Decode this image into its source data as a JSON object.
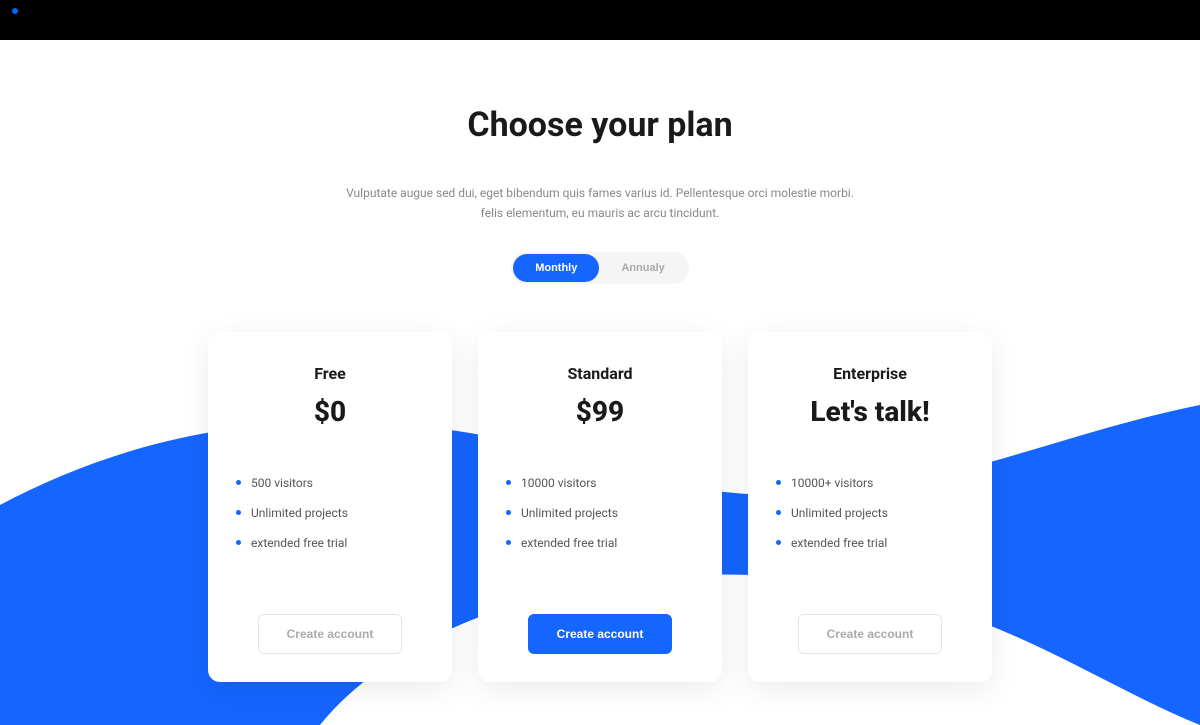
{
  "heading": "Choose your plan",
  "subtitle_line1": "Vulputate augue sed dui, eget bibendum quis fames varius id. Pellentesque orci molestie morbi.",
  "subtitle_line2": "felis elementum, eu mauris ac arcu tincidunt.",
  "toggle": {
    "monthly": "Monthly",
    "annually": "Annualy"
  },
  "plans": [
    {
      "name": "Free",
      "price": "$0",
      "features": [
        "500 visitors",
        "Unlimited projects",
        "extended free trial"
      ],
      "cta": "Create account",
      "primary": false
    },
    {
      "name": "Standard",
      "price": "$99",
      "features": [
        "10000 visitors",
        "Unlimited projects",
        "extended free trial"
      ],
      "cta": "Create account",
      "primary": true
    },
    {
      "name": "Enterprise",
      "price": "Let's talk!",
      "features": [
        "10000+ visitors",
        "Unlimited projects",
        "extended free trial"
      ],
      "cta": "Create account",
      "primary": false
    }
  ]
}
